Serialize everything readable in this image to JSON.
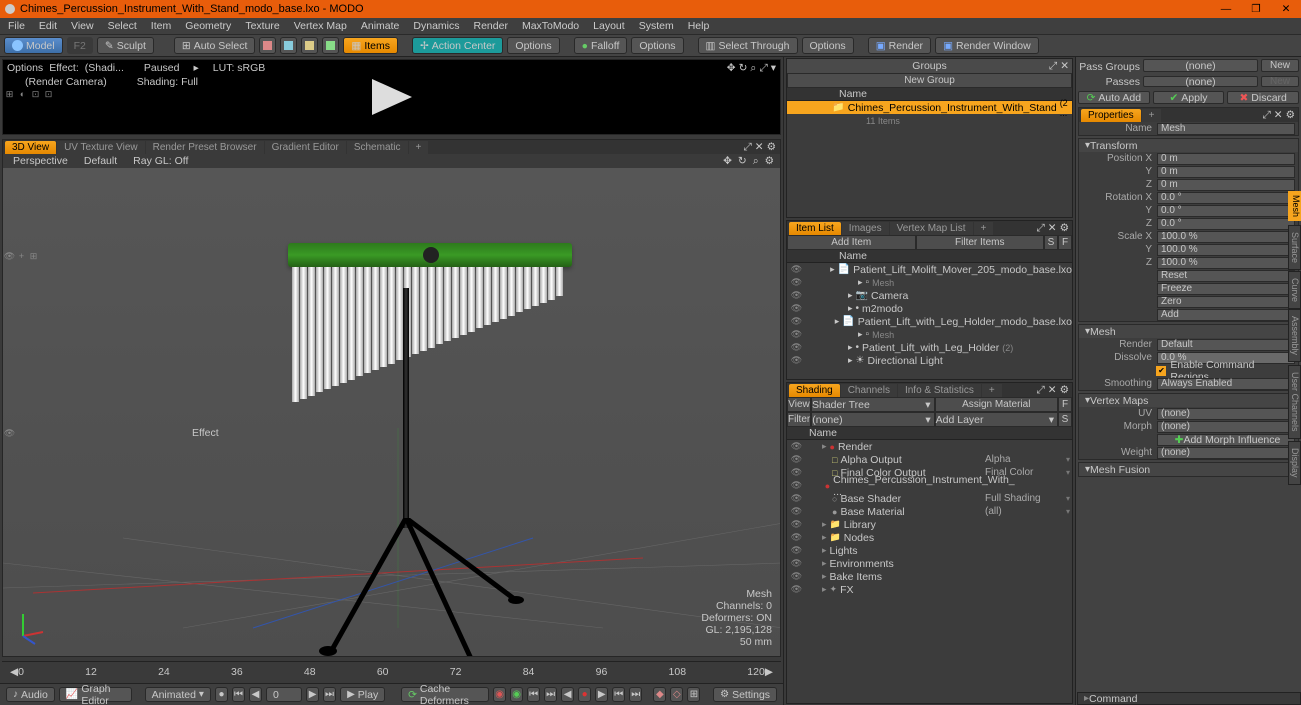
{
  "title": "Chimes_Percussion_Instrument_With_Stand_modo_base.lxo - MODO",
  "menu": [
    "File",
    "Edit",
    "View",
    "Select",
    "Item",
    "Geometry",
    "Texture",
    "Vertex Map",
    "Animate",
    "Dynamics",
    "Render",
    "MaxToModo",
    "Layout",
    "System",
    "Help"
  ],
  "toolbar": {
    "model": "Model",
    "sculpt": "Sculpt",
    "autoselect": "Auto Select",
    "items": "Items",
    "actioncenter": "Action Center",
    "options": "Options",
    "falloff": "Falloff",
    "selectthrough": "Select Through",
    "render": "Render",
    "renderwin": "Render Window"
  },
  "preview": {
    "options": "Options",
    "effect_lbl": "Effect:",
    "effect": "(Shadi...",
    "paused": "Paused",
    "lut": "LUT: sRGB",
    "rendercam": "(Render Camera)",
    "shading": "Shading: Full"
  },
  "vptabs": [
    "3D View",
    "UV Texture View",
    "Render Preset Browser",
    "Gradient Editor",
    "Schematic",
    "+"
  ],
  "vptool": {
    "persp": "Perspective",
    "default": "Default",
    "raygl": "Ray GL: Off"
  },
  "stats": {
    "name": "Mesh",
    "channels": "Channels: 0",
    "deformers": "Deformers: ON",
    "gl": "GL: 2,195,128",
    "focal": "50 mm"
  },
  "timeline": [
    0,
    12,
    24,
    36,
    48,
    60,
    72,
    84,
    96,
    108,
    120
  ],
  "time_current": "0",
  "timectrl": {
    "audio": "Audio",
    "graph": "Graph Editor",
    "animated": "Animated",
    "play": "Play",
    "cache": "Cache Deformers",
    "settings": "Settings"
  },
  "groups": {
    "title": "Groups",
    "newgroup": "New Group",
    "name": "Name",
    "item": "Chimes_Percussion_Instrument_With_Stand",
    "meta": "(2 ...",
    "count": "11 Items"
  },
  "itemlist": {
    "tabs": [
      "Item List",
      "Images",
      "Vertex Map List",
      "+"
    ],
    "additem": "Add Item",
    "filter": "Filter Items",
    "name": "Name",
    "rows": [
      {
        "t": "Patient_Lift_Molift_Mover_205_modo_base.lxo",
        "d": 3,
        "ic": "📄"
      },
      {
        "t": "Mesh",
        "d": 5,
        "ic": "▫",
        "sel": false,
        "tiny": true
      },
      {
        "t": "Camera",
        "d": 4,
        "ic": "📷"
      },
      {
        "t": "m2modo",
        "d": 4,
        "ic": "•"
      },
      {
        "t": "Patient_Lift_with_Leg_Holder_modo_base.lxo",
        "d": 3,
        "ic": "📄"
      },
      {
        "t": "Mesh",
        "d": 5,
        "ic": "▫",
        "tiny": true
      },
      {
        "t": "Patient_Lift_with_Leg_Holder",
        "d": 4,
        "ic": "•",
        "meta": "(2)"
      },
      {
        "t": "Directional Light",
        "d": 4,
        "ic": "☀"
      }
    ]
  },
  "shading": {
    "tabs": [
      "Shading",
      "Channels",
      "Info & Statistics",
      "+"
    ],
    "view": "View",
    "shadertree": "Shader Tree",
    "assign": "Assign Material",
    "filter": "Filter",
    "none": "(none)",
    "addlayer": "Add Layer",
    "name": "Name",
    "effect": "Effect",
    "rows": [
      {
        "t": "Render",
        "e": "",
        "d": 1,
        "ic": "●",
        "c": "#c33"
      },
      {
        "t": "Alpha Output",
        "e": "Alpha",
        "d": 2,
        "ic": "□",
        "c": "#cc7"
      },
      {
        "t": "Final Color Output",
        "e": "Final Color",
        "d": 2,
        "ic": "□",
        "c": "#cc7"
      },
      {
        "t": "Chimes_Percussion_Instrument_With_ ...",
        "e": "",
        "d": 2,
        "ic": "●",
        "c": "#c33"
      },
      {
        "t": "Base Shader",
        "e": "Full Shading",
        "d": 2,
        "ic": "○",
        "c": "#999"
      },
      {
        "t": "Base Material",
        "e": "(all)",
        "d": 2,
        "ic": "●",
        "c": "#999"
      },
      {
        "t": "Library",
        "e": "",
        "d": 1,
        "ic": "📁"
      },
      {
        "t": "Nodes",
        "e": "",
        "d": 1,
        "ic": "📁"
      },
      {
        "t": "Lights",
        "e": "",
        "d": 1
      },
      {
        "t": "Environments",
        "e": "",
        "d": 1
      },
      {
        "t": "Bake Items",
        "e": "",
        "d": 1
      },
      {
        "t": "FX",
        "e": "",
        "d": 1,
        "ic": "✦"
      }
    ]
  },
  "right": {
    "passgroups": "Pass Groups",
    "none": "(none)",
    "new": "New",
    "passes": "Passes",
    "autoadd": "Auto Add",
    "apply": "Apply",
    "discard": "Discard",
    "properties": "Properties",
    "namelbl": "Name",
    "name": "Mesh",
    "transform": "Transform",
    "pos": "Position X",
    "posy": "Y",
    "posz": "Z",
    "pos_v": "0 m",
    "rot": "Rotation X",
    "rot_v": "0.0 °",
    "scl": "Scale X",
    "scl_v": "100.0 %",
    "reset": "Reset",
    "freeze": "Freeze",
    "zero": "Zero",
    "add": "Add",
    "mesh": "Mesh",
    "render": "Render",
    "default": "Default",
    "dissolve": "Dissolve",
    "dissolve_v": "0.0 %",
    "enable_cmd": "Enable Command Regions",
    "smoothing": "Smoothing",
    "always": "Always Enabled",
    "vmaps": "Vertex Maps",
    "uv": "UV",
    "morph": "Morph",
    "addmorph": "Add Morph Influence",
    "weight": "Weight",
    "meshfusion": "Mesh Fusion",
    "command": "Command",
    "vtabs": [
      "Mesh",
      "Surface",
      "Curve",
      "Assembly",
      "User Channels",
      "Display"
    ]
  }
}
